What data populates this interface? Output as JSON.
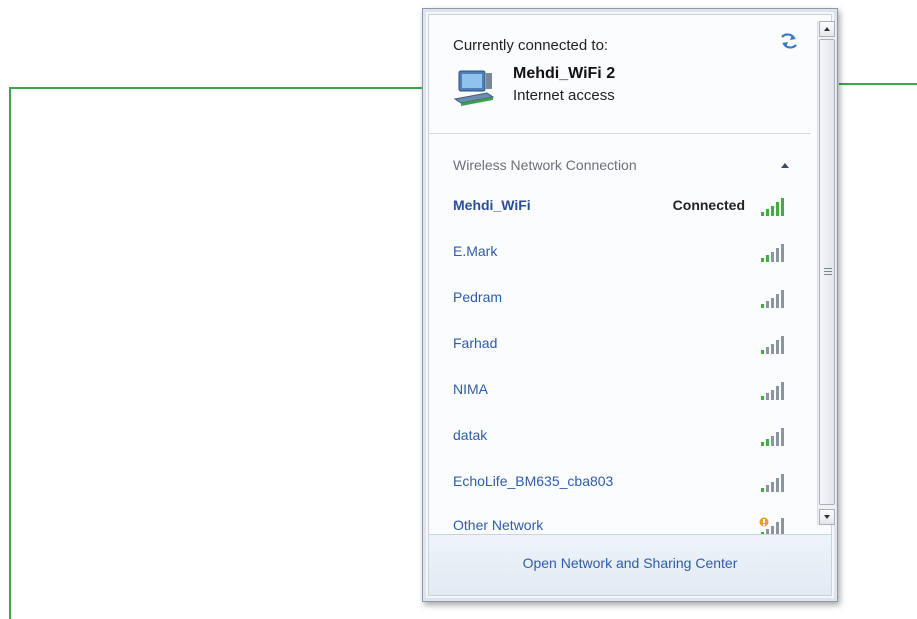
{
  "connected_panel": {
    "title": "Currently connected to:",
    "network_name": "Mehdi_WiFi 2",
    "network_status": "Internet access"
  },
  "section": {
    "title": "Wireless Network Connection"
  },
  "networks": [
    {
      "name": "Mehdi_WiFi",
      "status": "Connected"
    },
    {
      "name": "E.Mark",
      "status": ""
    },
    {
      "name": "Pedram",
      "status": ""
    },
    {
      "name": "Farhad",
      "status": ""
    },
    {
      "name": "NIMA",
      "status": ""
    },
    {
      "name": "datak",
      "status": ""
    },
    {
      "name": "EchoLife_BM635_cba803",
      "status": ""
    },
    {
      "name": "Other Network",
      "status": ""
    }
  ],
  "footer": {
    "link": "Open Network and Sharing Center"
  },
  "colors": {
    "accent_line": "#3aa64a",
    "link_blue": "#2f5ca8",
    "signal_green": "#3fae3a"
  },
  "icons": {
    "refresh": "refresh-icon",
    "network": "network-computer-icon",
    "collapse": "chevron-up-icon",
    "signal": "wifi-signal-icon",
    "other_signal": "wifi-signal-warning-icon"
  }
}
